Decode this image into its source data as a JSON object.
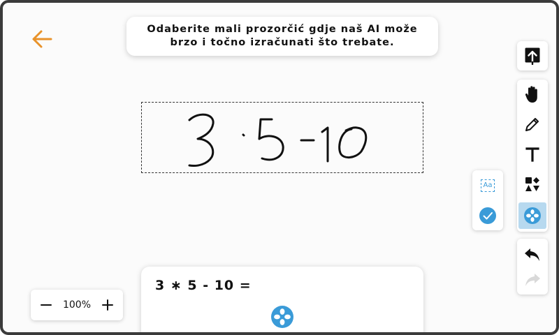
{
  "banner": {
    "line1": "Odaberite mali prozorčić gdje naš AI može",
    "line2": "brzo i točno izračunati što trebate."
  },
  "colors": {
    "accent": "#3a9bd8",
    "back_arrow": "#e8922a",
    "active_tool_bg": "#b7d9ef"
  },
  "canvas": {
    "handwriting_text": "3·5-10"
  },
  "toolbar": {
    "top": [
      {
        "icon": "upload-icon"
      }
    ],
    "main": [
      {
        "icon": "hand-icon",
        "active": false
      },
      {
        "icon": "pencil-icon",
        "active": false
      },
      {
        "icon": "text-icon",
        "active": false
      },
      {
        "icon": "shapes-icon",
        "active": false
      },
      {
        "icon": "ai-solver-icon",
        "active": true
      }
    ],
    "history": [
      {
        "icon": "undo-icon",
        "enabled": true
      },
      {
        "icon": "redo-icon",
        "enabled": false
      }
    ]
  },
  "sub_toolbar": {
    "text_recognition_label": "Aa",
    "confirm_icon": "check-icon"
  },
  "zoom": {
    "level": "100%"
  },
  "result": {
    "expression": "3 ∗ 5 - 10 ="
  }
}
